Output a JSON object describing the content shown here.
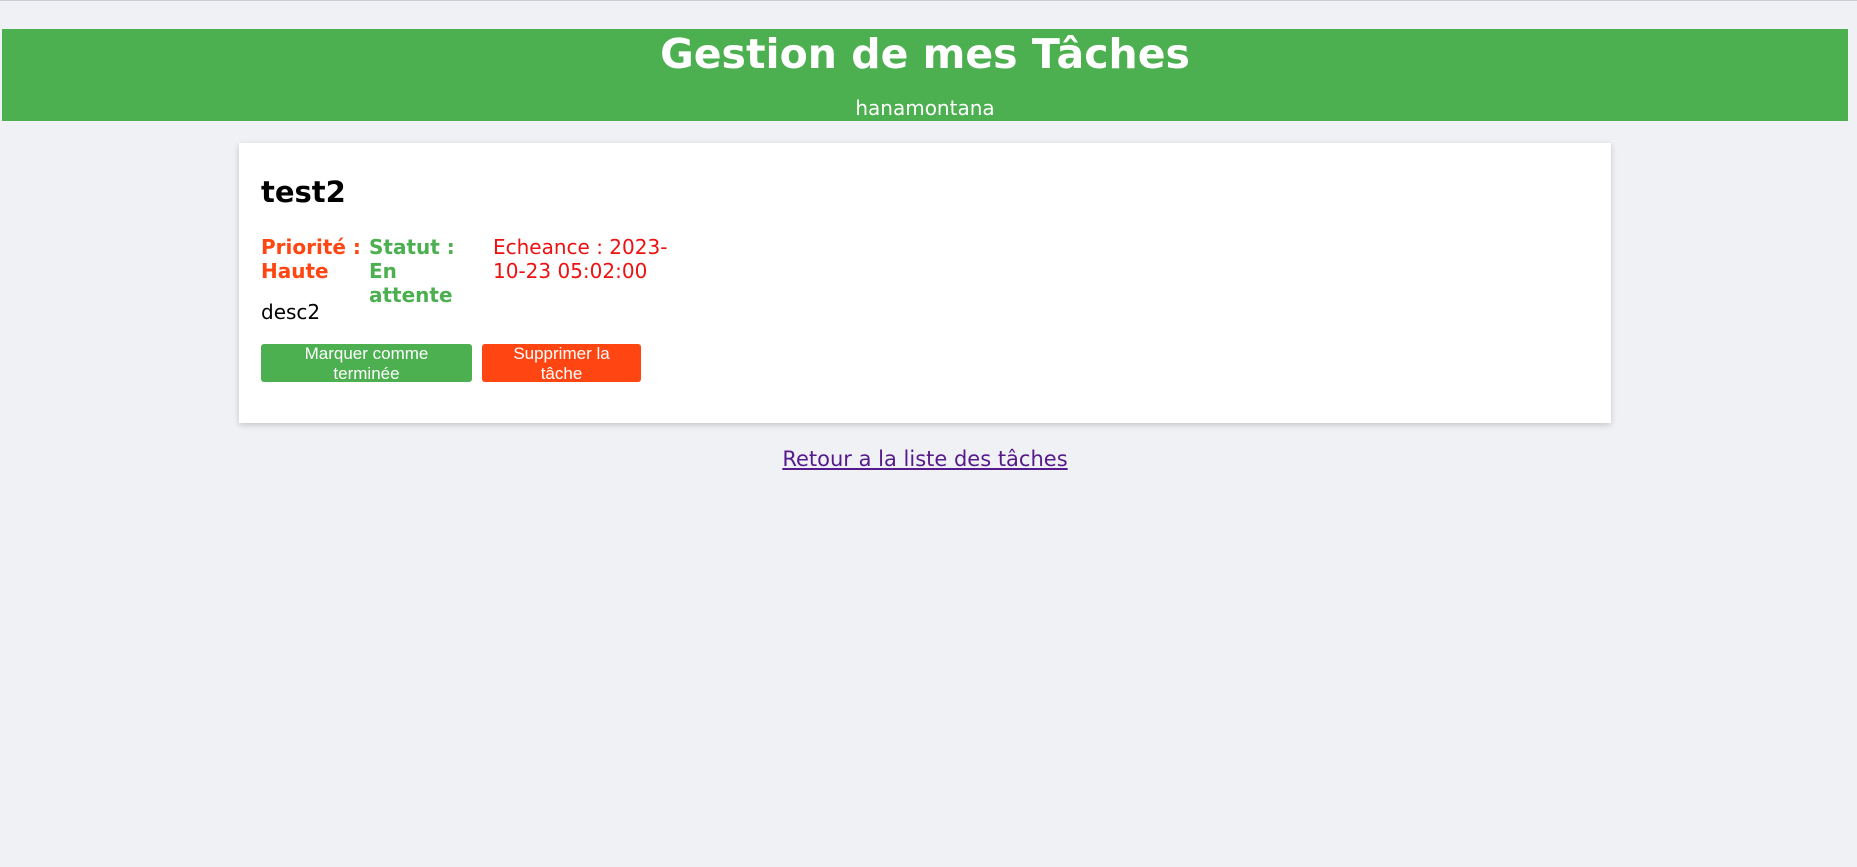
{
  "header": {
    "title": "Gestion de mes Tâches",
    "username": "hanamontana"
  },
  "task": {
    "title": "test2",
    "priority": "Priorité : Haute",
    "status": "Statut : En attente",
    "deadline": "Echeance : 2023-10-23 05:02:00",
    "description": "desc2"
  },
  "actions": {
    "mark_done_label": "Marquer comme terminée",
    "delete_label": "Supprimer la tâche"
  },
  "back_link": {
    "label": "Retour a la liste des tâches"
  },
  "colors": {
    "header_bg": "#4caf50",
    "priority_high": "#ff4511",
    "status_pending": "#4caf50",
    "deadline": "#ee1111",
    "button_done": "#4caf50",
    "button_delete": "#ff4511",
    "link_visited": "#551a8b"
  }
}
